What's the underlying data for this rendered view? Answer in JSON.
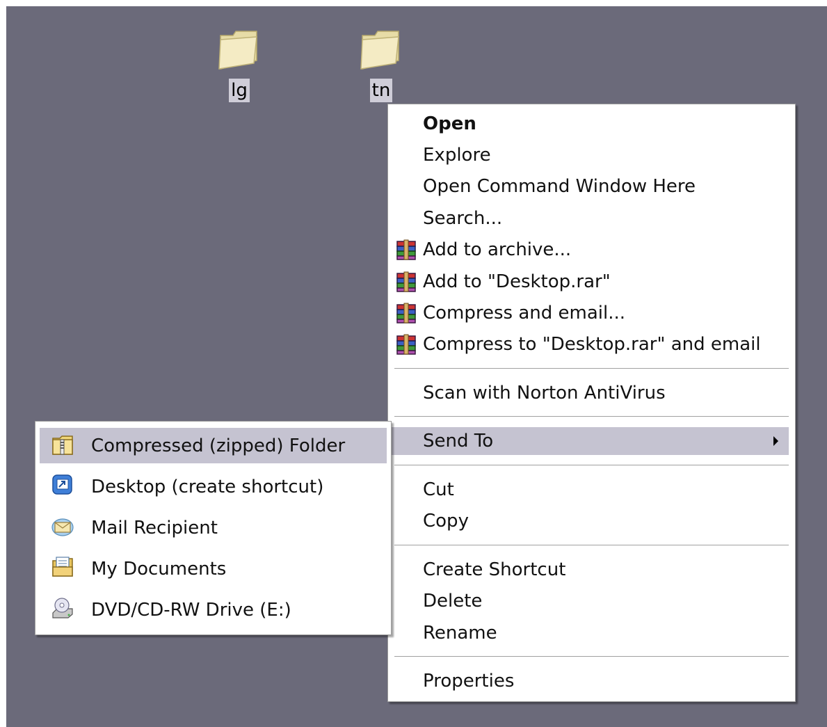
{
  "desktop": {
    "background_color": "#6b6a7a",
    "icons": [
      {
        "label": "lg",
        "icon": "folder-icon"
      },
      {
        "label": "tn",
        "icon": "folder-icon"
      }
    ]
  },
  "context_menu": {
    "items": [
      {
        "label": "Open",
        "default": true
      },
      {
        "label": "Explore"
      },
      {
        "label": "Open Command Window Here"
      },
      {
        "label": "Search..."
      },
      {
        "label": "Add to archive...",
        "icon": "winrar-icon"
      },
      {
        "label": "Add to \"Desktop.rar\"",
        "icon": "winrar-icon"
      },
      {
        "label": "Compress and email...",
        "icon": "winrar-icon"
      },
      {
        "label": "Compress to \"Desktop.rar\" and email",
        "icon": "winrar-icon"
      },
      {
        "label": "Scan with Norton AntiVirus"
      },
      {
        "label": "Send To",
        "submenu": true,
        "highlighted": true
      },
      {
        "label": "Cut"
      },
      {
        "label": "Copy"
      },
      {
        "label": "Create Shortcut"
      },
      {
        "label": "Delete"
      },
      {
        "label": "Rename"
      },
      {
        "label": "Properties"
      }
    ]
  },
  "send_to_menu": {
    "items": [
      {
        "label": "Compressed (zipped) Folder",
        "icon": "zip-folder-icon",
        "highlighted": true
      },
      {
        "label": "Desktop (create shortcut)",
        "icon": "desktop-shortcut-icon"
      },
      {
        "label": "Mail Recipient",
        "icon": "mail-icon"
      },
      {
        "label": "My Documents",
        "icon": "my-documents-icon"
      },
      {
        "label": "DVD/CD-RW Drive (E:)",
        "icon": "cd-drive-icon"
      }
    ]
  },
  "colors": {
    "highlight": "#c5c3d1",
    "label_bg": "#cfcdd8"
  }
}
